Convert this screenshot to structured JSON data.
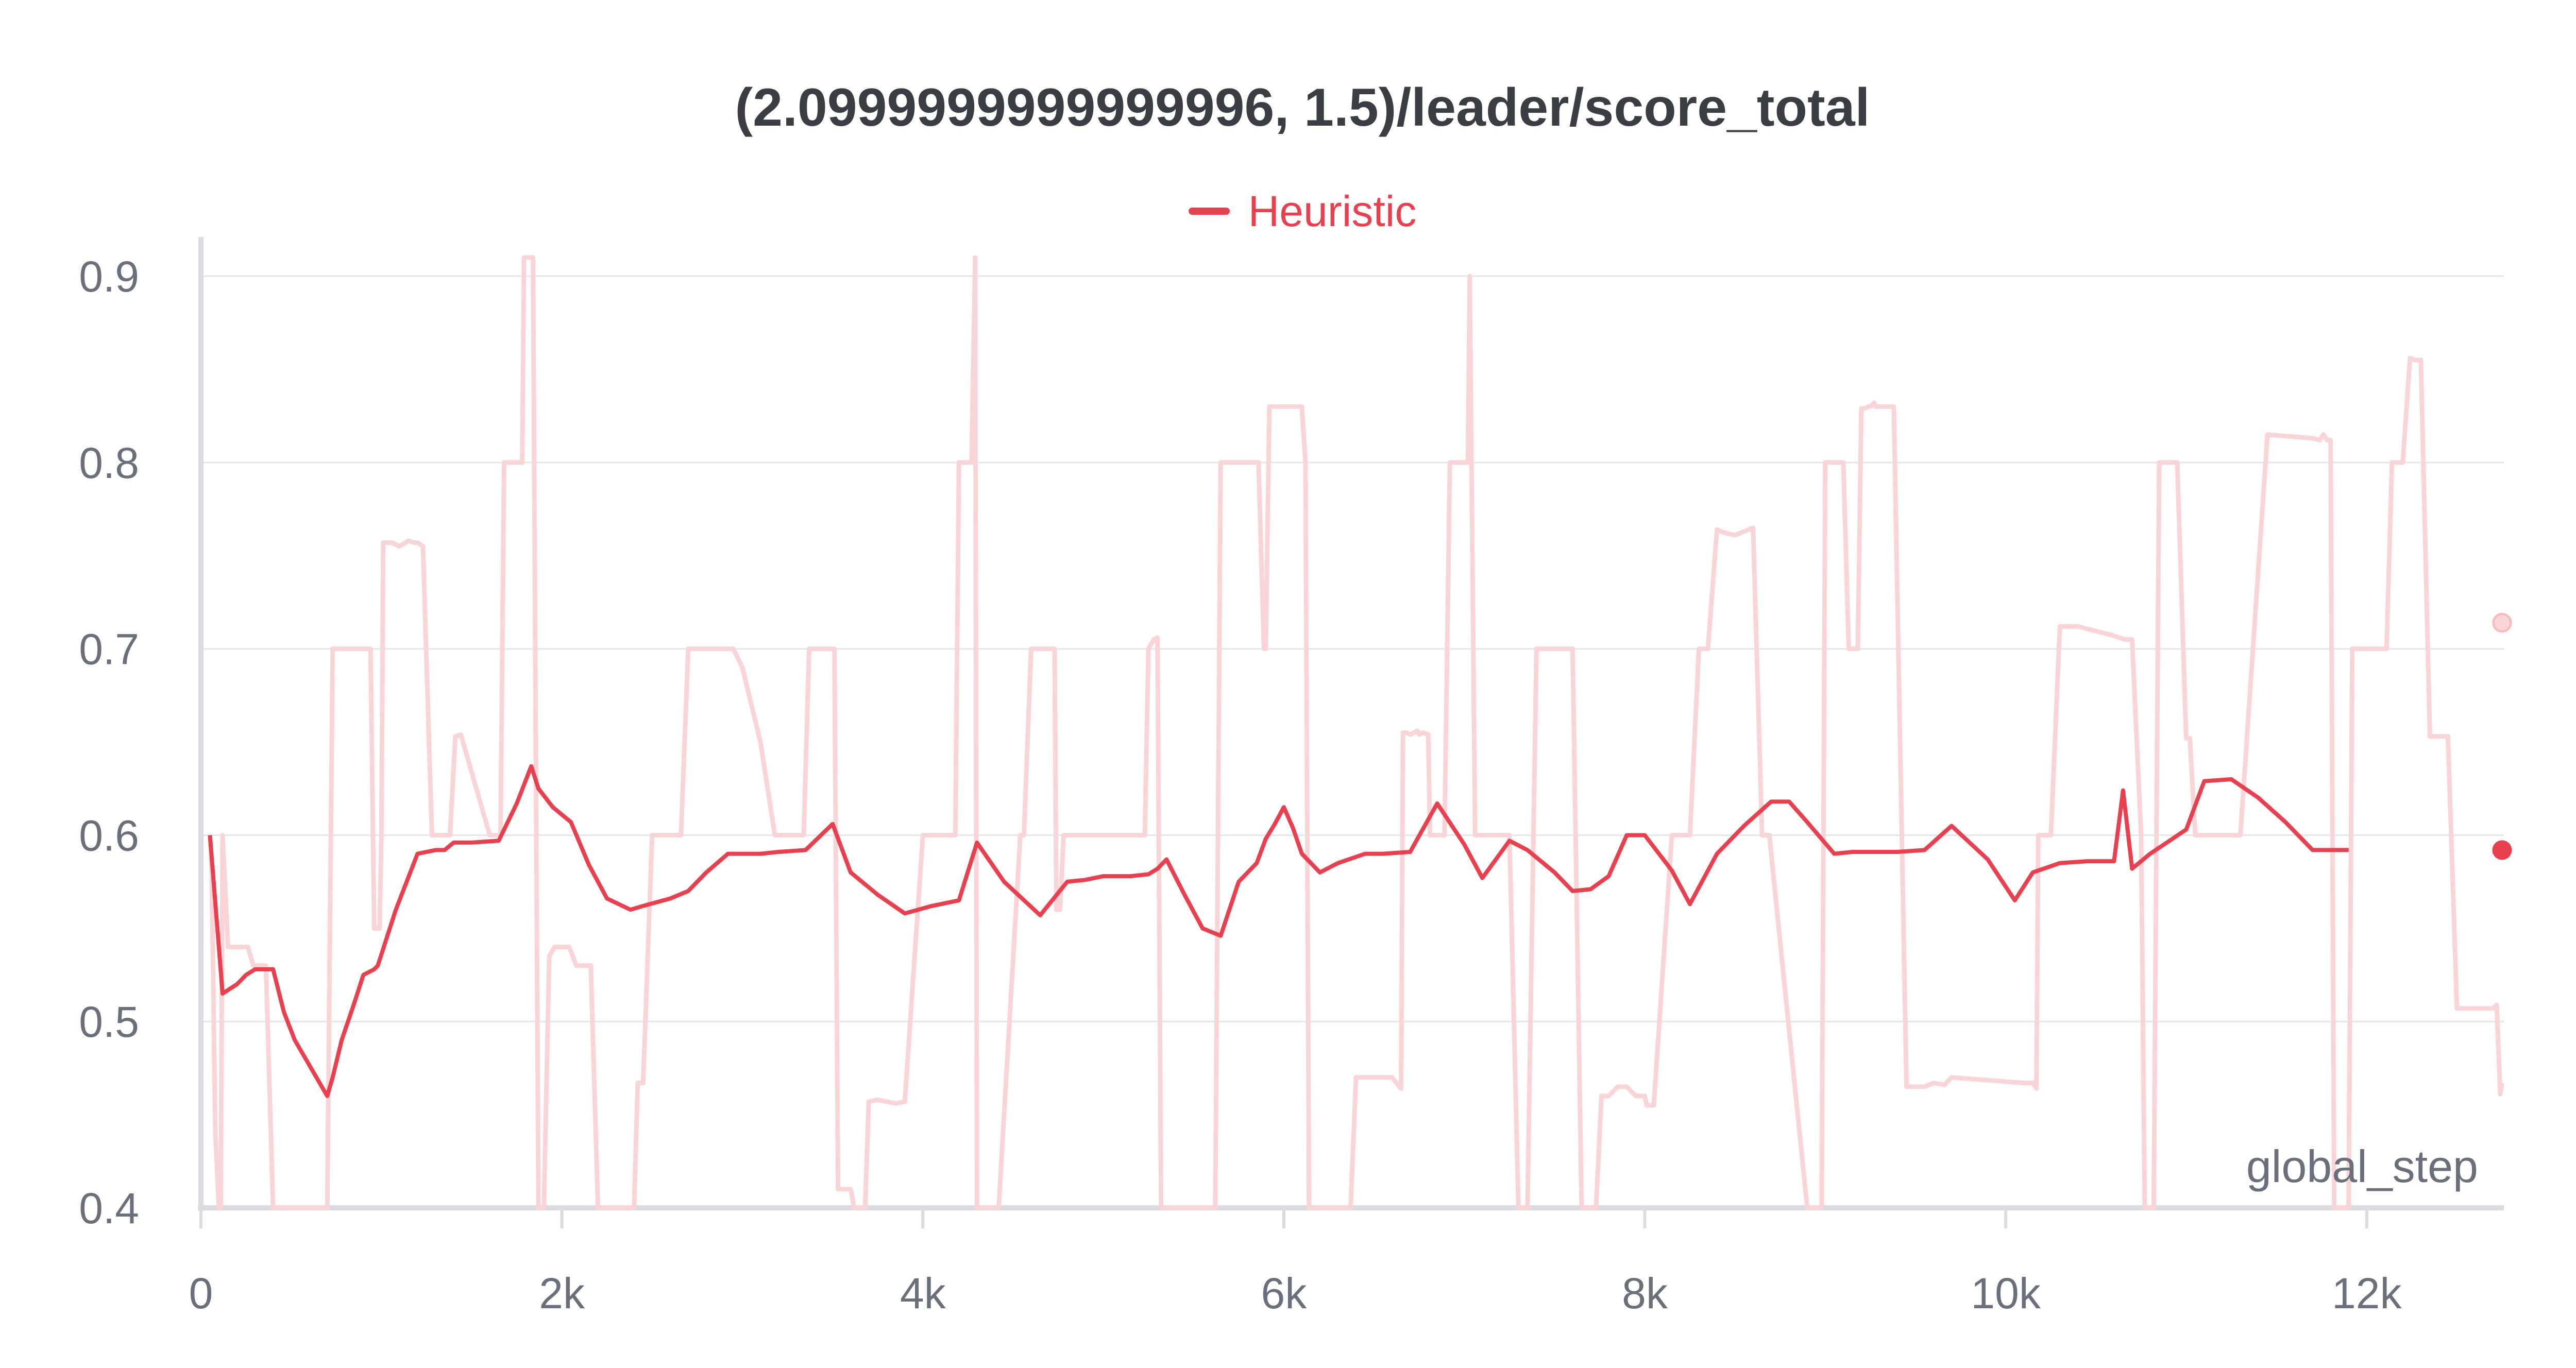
{
  "chart_data": {
    "type": "line",
    "title": "(2.0999999999999996, 1.5)/leader/score_total",
    "xlabel": "global_step",
    "ylabel": "",
    "xlim": [
      0,
      12760
    ],
    "ylim": [
      0.4,
      0.91
    ],
    "x_ticks": [
      {
        "value": 0,
        "label": "0"
      },
      {
        "value": 2000,
        "label": "2k"
      },
      {
        "value": 4000,
        "label": "4k"
      },
      {
        "value": 6000,
        "label": "6k"
      },
      {
        "value": 8000,
        "label": "8k"
      },
      {
        "value": 10000,
        "label": "10k"
      },
      {
        "value": 12000,
        "label": "12k"
      }
    ],
    "y_ticks": [
      {
        "value": 0.4,
        "label": "0.4"
      },
      {
        "value": 0.5,
        "label": "0.5"
      },
      {
        "value": 0.6,
        "label": "0.6"
      },
      {
        "value": 0.7,
        "label": "0.7"
      },
      {
        "value": 0.8,
        "label": "0.8"
      },
      {
        "value": 0.9,
        "label": "0.9"
      }
    ],
    "grid": true,
    "legend_position": "top-center",
    "series": [
      {
        "name": "Heuristic",
        "color": "#e8404f",
        "raw_color": "#f9d5d8",
        "raw": {
          "x": [
            50,
            60,
            80,
            100,
            110,
            120,
            150,
            180,
            200,
            230,
            260,
            290,
            320,
            360,
            400,
            420,
            450,
            550,
            650,
            700,
            730,
            750,
            790,
            820,
            870,
            890,
            900,
            940,
            960,
            980,
            990,
            1000,
            1010,
            1040,
            1060,
            1100,
            1150,
            1180,
            1200,
            1230,
            1280,
            1320,
            1340,
            1360,
            1370,
            1380,
            1410,
            1440,
            1600,
            1660,
            1680,
            1700,
            1720,
            1740,
            1760,
            1780,
            1790,
            1800,
            1820,
            1830,
            1840,
            1870,
            1880,
            1890,
            1900,
            1930,
            1960,
            1990,
            2000,
            2040,
            2080,
            2110,
            2130,
            2160,
            2200,
            2250,
            2380,
            2400,
            2420,
            2450,
            2500,
            2590,
            2630,
            2660,
            2700,
            2800,
            2920,
            2950,
            3000,
            3100,
            3180,
            3300,
            3340,
            3370,
            3400,
            3450,
            3500,
            3510,
            3530,
            3560,
            3600,
            3620,
            3650,
            3680,
            3700,
            3750,
            3800,
            3850,
            3900,
            4000,
            4020,
            4040,
            4060,
            4100,
            4140,
            4180,
            4200,
            4230,
            4250,
            4260,
            4270,
            4290,
            4300,
            4310,
            4330,
            4420,
            4540,
            4560,
            4600,
            4610,
            4640,
            4680,
            4700,
            4730,
            4740,
            4760,
            4780,
            4900,
            5000,
            5150,
            5230,
            5250,
            5280,
            5300,
            5320,
            5600,
            5620,
            5650,
            5660,
            5700,
            5750,
            5800,
            5820,
            5860,
            5890,
            5900,
            5920,
            5940,
            5960,
            5980,
            6000,
            6050,
            6100,
            6120,
            6140,
            6180,
            6250,
            6270,
            6300,
            6320,
            6340,
            6370,
            6400,
            6600,
            6640,
            6650,
            6660,
            6680,
            6700,
            6720,
            6740,
            6750,
            6770,
            6800,
            6810,
            6830,
            6840,
            6850,
            6860,
            6870,
            6890,
            6920,
            6960,
            7000,
            7010,
            7020,
            7030,
            7060,
            7250,
            7300,
            7350,
            7400,
            7530,
            7550,
            7570,
            7600,
            7650,
            7730,
            7760,
            7800,
            7850,
            7900,
            7950,
            8000,
            8010,
            8050,
            8150,
            8200,
            8250,
            8300,
            8350,
            8400,
            8450,
            8500,
            8600,
            8650,
            8690,
            8900,
            8920,
            8940,
            8960,
            8980,
            9000,
            9050,
            9060,
            9100,
            9130,
            9170,
            9180,
            9200,
            9220,
            9240,
            9250,
            9270,
            9280,
            9300,
            9320,
            9380,
            9450,
            9550,
            9600,
            9660,
            9700,
            10100,
            10150,
            10170,
            10180,
            10210,
            10230,
            10250,
            10300,
            10400,
            10600,
            10630,
            10660,
            10700,
            10750,
            10770,
            10800,
            10820,
            10850,
            10900,
            10950,
            11000,
            11020,
            11050,
            11100,
            11150,
            11200,
            11220,
            11250,
            11300,
            11450,
            11700,
            11740,
            11760,
            11780,
            11800,
            11820,
            11840,
            11860,
            11900,
            11920,
            11960,
            12000,
            12050,
            12100,
            12110,
            12140,
            12180,
            12200,
            12240,
            12270,
            12300,
            12350,
            12400,
            12450,
            12500,
            12550,
            12600,
            12700,
            12720,
            12740,
            12750
          ],
          "y": [
            0.6,
            0.58,
            0.44,
            0.4,
            0.4,
            0.6,
            0.54,
            0.54,
            0.54,
            0.54,
            0.54,
            0.53,
            0.53,
            0.53,
            0.4,
            0.4,
            0.4,
            0.4,
            0.4,
            0.4,
            0.7,
            0.7,
            0.7,
            0.7,
            0.7,
            0.7,
            0.7,
            0.7,
            0.55,
            0.55,
            0.55,
            0.6,
            0.757,
            0.757,
            0.757,
            0.755,
            0.758,
            0.757,
            0.757,
            0.755,
            0.6,
            0.6,
            0.6,
            0.6,
            0.6,
            0.6,
            0.653,
            0.654,
            0.6,
            0.6,
            0.8,
            0.8,
            0.8,
            0.8,
            0.8,
            0.8,
            0.915,
            0.912,
            0.912,
            0.91,
            0.91,
            0.4,
            0.4,
            0.4,
            0.4,
            0.535,
            0.54,
            0.54,
            0.54,
            0.54,
            0.53,
            0.53,
            0.53,
            0.53,
            0.4,
            0.4,
            0.4,
            0.4,
            0.467,
            0.467,
            0.6,
            0.6,
            0.6,
            0.6,
            0.7,
            0.7,
            0.7,
            0.7,
            0.69,
            0.65,
            0.6,
            0.6,
            0.6,
            0.7,
            0.7,
            0.7,
            0.7,
            0.7,
            0.41,
            0.41,
            0.41,
            0.4,
            0.4,
            0.4,
            0.457,
            0.458,
            0.457,
            0.456,
            0.457,
            0.6,
            0.6,
            0.6,
            0.6,
            0.6,
            0.6,
            0.6,
            0.8,
            0.8,
            0.8,
            0.8,
            0.8,
            0.91,
            0.4,
            0.4,
            0.4,
            0.4,
            0.6,
            0.6,
            0.7,
            0.7,
            0.7,
            0.7,
            0.7,
            0.7,
            0.56,
            0.56,
            0.6,
            0.6,
            0.6,
            0.6,
            0.6,
            0.7,
            0.705,
            0.706,
            0.4,
            0.4,
            0.4,
            0.8,
            0.8,
            0.8,
            0.8,
            0.8,
            0.8,
            0.8,
            0.7,
            0.7,
            0.83,
            0.83,
            0.83,
            0.83,
            0.83,
            0.83,
            0.83,
            0.8,
            0.4,
            0.4,
            0.4,
            0.4,
            0.4,
            0.4,
            0.4,
            0.4,
            0.47,
            0.47,
            0.465,
            0.464,
            0.655,
            0.655,
            0.654,
            0.655,
            0.656,
            0.654,
            0.655,
            0.654,
            0.6,
            0.6,
            0.6,
            0.6,
            0.6,
            0.6,
            0.6,
            0.8,
            0.8,
            0.8,
            0.8,
            0.8,
            0.9,
            0.6,
            0.6,
            0.4,
            0.4,
            0.7,
            0.7,
            0.7,
            0.7,
            0.7,
            0.4,
            0.4,
            0.46,
            0.46,
            0.465,
            0.465,
            0.46,
            0.46,
            0.455,
            0.455,
            0.6,
            0.6,
            0.6,
            0.7,
            0.7,
            0.764,
            0.762,
            0.761,
            0.765,
            0.6,
            0.6,
            0.4,
            0.4,
            0.4,
            0.4,
            0.4,
            0.8,
            0.8,
            0.8,
            0.8,
            0.7,
            0.7,
            0.7,
            0.829,
            0.829,
            0.83,
            0.83,
            0.832,
            0.83,
            0.83,
            0.83,
            0.83,
            0.465,
            0.465,
            0.467,
            0.466,
            0.47,
            0.467,
            0.467,
            0.464,
            0.6,
            0.6,
            0.6,
            0.6,
            0.712,
            0.712,
            0.707,
            0.706,
            0.705,
            0.705,
            0.6,
            0.4,
            0.4,
            0.4,
            0.8,
            0.8,
            0.8,
            0.652,
            0.652,
            0.6,
            0.6,
            0.6,
            0.6,
            0.6,
            0.6,
            0.6,
            0.815,
            0.813,
            0.812,
            0.815,
            0.812,
            0.812,
            0.4,
            0.4,
            0.4,
            0.4,
            0.7,
            0.7,
            0.7,
            0.7,
            0.7,
            0.7,
            0.8,
            0.8,
            0.8,
            0.856,
            0.855,
            0.855,
            0.653,
            0.653,
            0.653,
            0.507,
            0.507,
            0.507,
            0.507,
            0.509,
            0.461,
            0.467,
            0.467,
            0.466,
            0.467,
            0.6,
            0.6,
            0.6,
            0.714
          ]
        },
        "smoothed": {
          "x": [
            50,
            120,
            200,
            250,
            300,
            350,
            400,
            460,
            520,
            580,
            640,
            700,
            730,
            780,
            850,
            900,
            960,
            980,
            1020,
            1080,
            1200,
            1300,
            1350,
            1400,
            1500,
            1650,
            1750,
            1830,
            1870,
            1950,
            2050,
            2150,
            2250,
            2380,
            2450,
            2600,
            2700,
            2800,
            2920,
            3000,
            3100,
            3200,
            3350,
            3500,
            3600,
            3750,
            3900,
            4050,
            4200,
            4300,
            4450,
            4650,
            4800,
            4900,
            5000,
            5100,
            5150,
            5250,
            5300,
            5350,
            5450,
            5550,
            5650,
            5750,
            5850,
            5900,
            5950,
            6000,
            6050,
            6100,
            6200,
            6300,
            6450,
            6550,
            6700,
            6850,
            7000,
            7100,
            7250,
            7350,
            7500,
            7600,
            7700,
            7800,
            7900,
            8000,
            8150,
            8250,
            8400,
            8550,
            8700,
            8800,
            8900,
            9050,
            9150,
            9300,
            9400,
            9550,
            9700,
            9900,
            10050,
            10150,
            10300,
            10450,
            10600,
            10650,
            10700,
            10800,
            11000,
            11100,
            11250,
            11400,
            11550,
            11700,
            11800,
            11900,
            12000,
            12100,
            12200,
            12300,
            12400,
            12500,
            12600,
            12750
          ],
          "y": [
            0.6,
            0.515,
            0.52,
            0.525,
            0.528,
            0.528,
            0.528,
            0.505,
            0.49,
            0.48,
            0.47,
            0.46,
            0.47,
            0.49,
            0.51,
            0.525,
            0.528,
            0.53,
            0.542,
            0.56,
            0.59,
            0.592,
            0.592,
            0.596,
            0.596,
            0.597,
            0.617,
            0.637,
            0.625,
            0.615,
            0.607,
            0.584,
            0.566,
            0.56,
            0.562,
            0.566,
            0.57,
            0.58,
            0.59,
            0.59,
            0.59,
            0.591,
            0.592,
            0.606,
            0.58,
            0.568,
            0.558,
            0.562,
            0.565,
            0.596,
            0.575,
            0.557,
            0.575,
            0.576,
            0.578,
            0.578,
            0.578,
            0.579,
            0.582,
            0.587,
            0.568,
            0.55,
            0.546,
            0.575,
            0.585,
            0.598,
            0.606,
            0.615,
            0.604,
            0.59,
            0.58,
            0.585,
            0.59,
            0.59,
            0.591,
            0.617,
            0.595,
            0.577,
            0.597,
            0.592,
            0.58,
            0.57,
            0.571,
            0.578,
            0.6,
            0.6,
            0.581,
            0.563,
            0.59,
            0.605,
            0.618,
            0.618,
            0.607,
            0.59,
            0.591,
            0.591,
            0.591,
            0.592,
            0.605,
            0.587,
            0.565,
            0.58,
            0.585,
            0.586,
            0.586,
            0.624,
            0.582,
            0.59,
            0.603,
            0.629,
            0.63,
            0.62,
            0.607,
            0.592,
            0.592,
            0.592
          ]
        }
      }
    ]
  }
}
